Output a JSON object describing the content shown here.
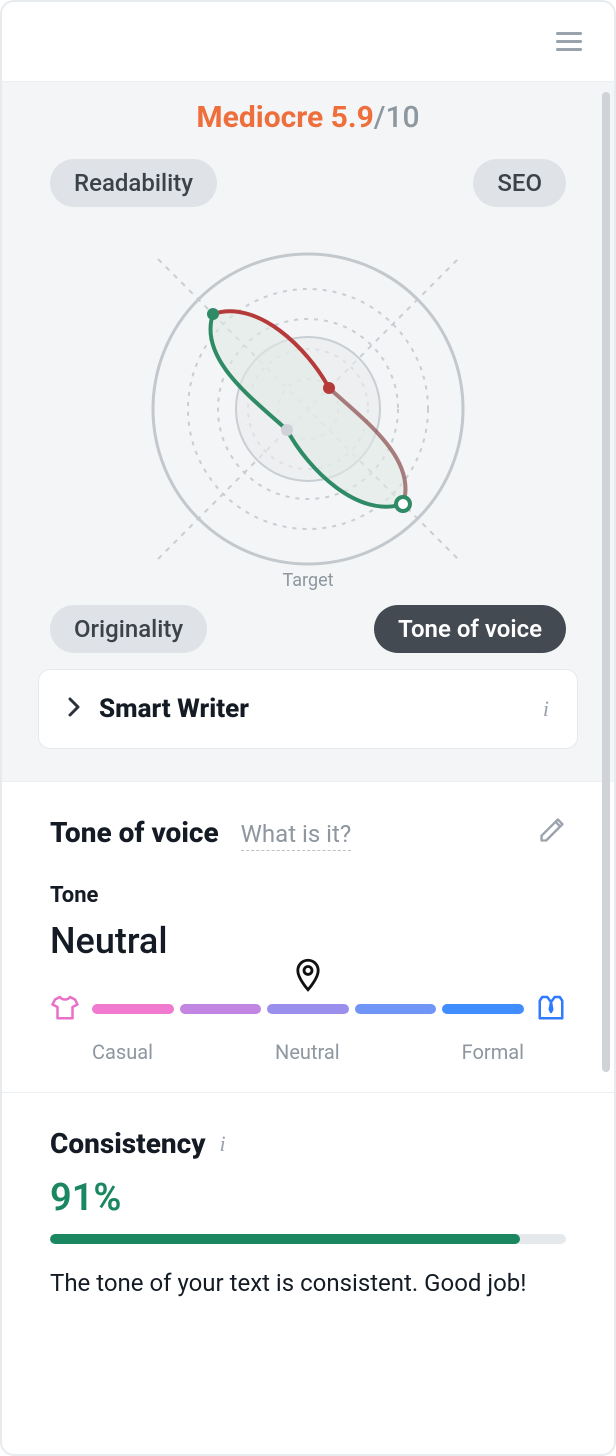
{
  "score": {
    "word": "Mediocre",
    "value": "5.9",
    "out_of": "/10"
  },
  "radar_pills": {
    "readability": "Readability",
    "seo": "SEO",
    "originality": "Originality",
    "tone": "Tone of voice"
  },
  "radar": {
    "target_label": "Target"
  },
  "chart_data": {
    "type": "radar",
    "axes": [
      "Readability",
      "SEO",
      "Originality",
      "Tone of voice"
    ],
    "series": [
      {
        "name": "Score",
        "values": [
          9,
          2,
          2,
          9
        ]
      },
      {
        "name": "Target",
        "values": [
          5,
          5,
          5,
          5
        ]
      }
    ],
    "scale": {
      "min": 0,
      "max": 10
    },
    "active_axis": "Tone of voice",
    "title": "",
    "legend": [
      "Target"
    ]
  },
  "smart_writer": {
    "title": "Smart Writer"
  },
  "tone_section": {
    "title": "Tone of voice",
    "what_is_it": "What is it?",
    "sub_label": "Tone",
    "value": "Neutral",
    "scale_labels": {
      "left": "Casual",
      "mid": "Neutral",
      "right": "Formal"
    },
    "position": 0.5
  },
  "consistency": {
    "title": "Consistency",
    "value_pct": 91,
    "value_text": "91%",
    "message": "The tone of your text is consistent. Good job!"
  }
}
